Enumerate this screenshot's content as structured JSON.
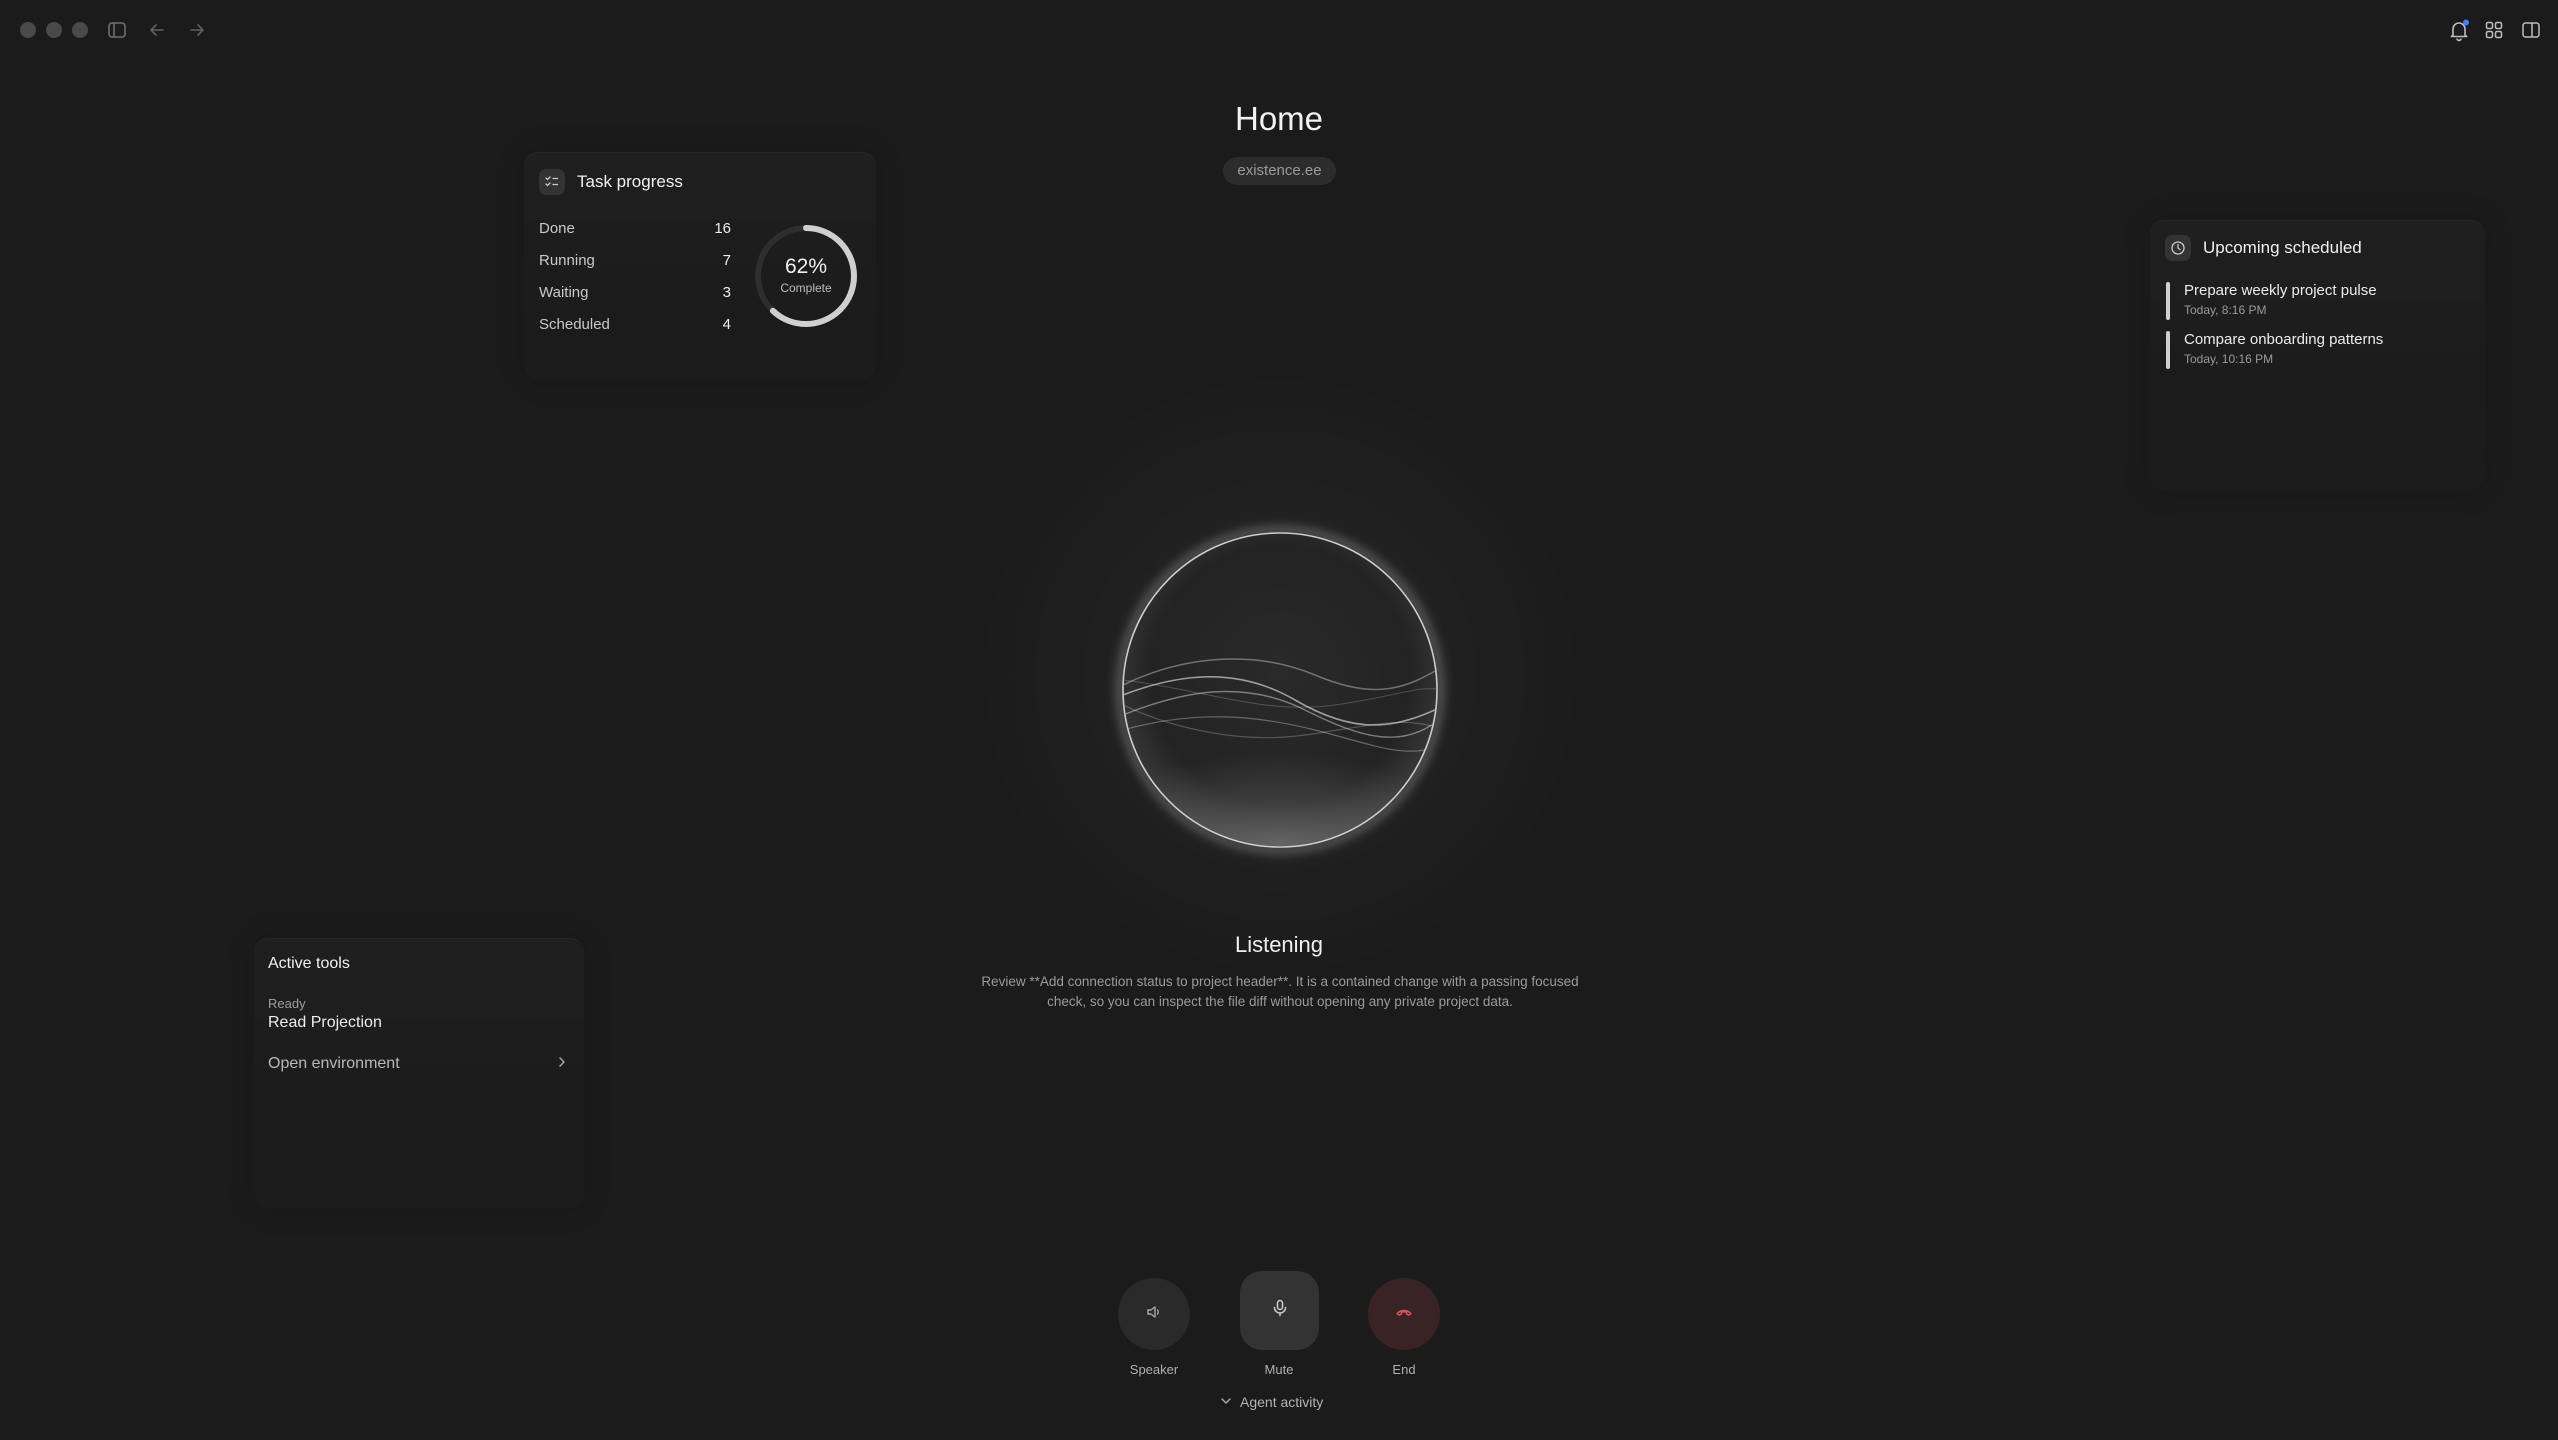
{
  "header": {
    "title": "Home",
    "workspace": "existence.ee"
  },
  "task_progress": {
    "title": "Task progress",
    "rows": [
      {
        "label": "Done",
        "value": "16"
      },
      {
        "label": "Running",
        "value": "7"
      },
      {
        "label": "Waiting",
        "value": "3"
      },
      {
        "label": "Scheduled",
        "value": "4"
      }
    ],
    "percent": "62%",
    "percent_value": 0.62,
    "percent_label": "Complete"
  },
  "upcoming": {
    "title": "Upcoming scheduled",
    "items": [
      {
        "title": "Prepare weekly project pulse",
        "time": "Today, 8:16 PM"
      },
      {
        "title": "Compare onboarding patterns",
        "time": "Today, 10:16 PM"
      }
    ]
  },
  "status": {
    "title": "Listening",
    "description": "Review **Add connection status to project header**. It is a contained change with a passing focused check, so you can inspect the file diff without opening any private project data."
  },
  "active_tools": {
    "title": "Active tools",
    "state": "Ready",
    "tool": "Read Projection",
    "link": "Open environment"
  },
  "controls": {
    "speaker": "Speaker",
    "mute": "Mute",
    "end": "End",
    "agent_activity": "Agent activity"
  },
  "colors": {
    "background": "#1b1b1b",
    "end_accent": "#e0525a",
    "notification_dot": "#3b82f6"
  },
  "icons": [
    "sidebar-toggle-icon",
    "back-arrow-icon",
    "forward-arrow-icon",
    "bell-icon",
    "grid-icon",
    "split-view-icon",
    "checklist-icon",
    "clock-icon",
    "chevron-right-icon",
    "speaker-icon",
    "microphone-icon",
    "phone-hangup-icon",
    "chevron-down-icon"
  ]
}
